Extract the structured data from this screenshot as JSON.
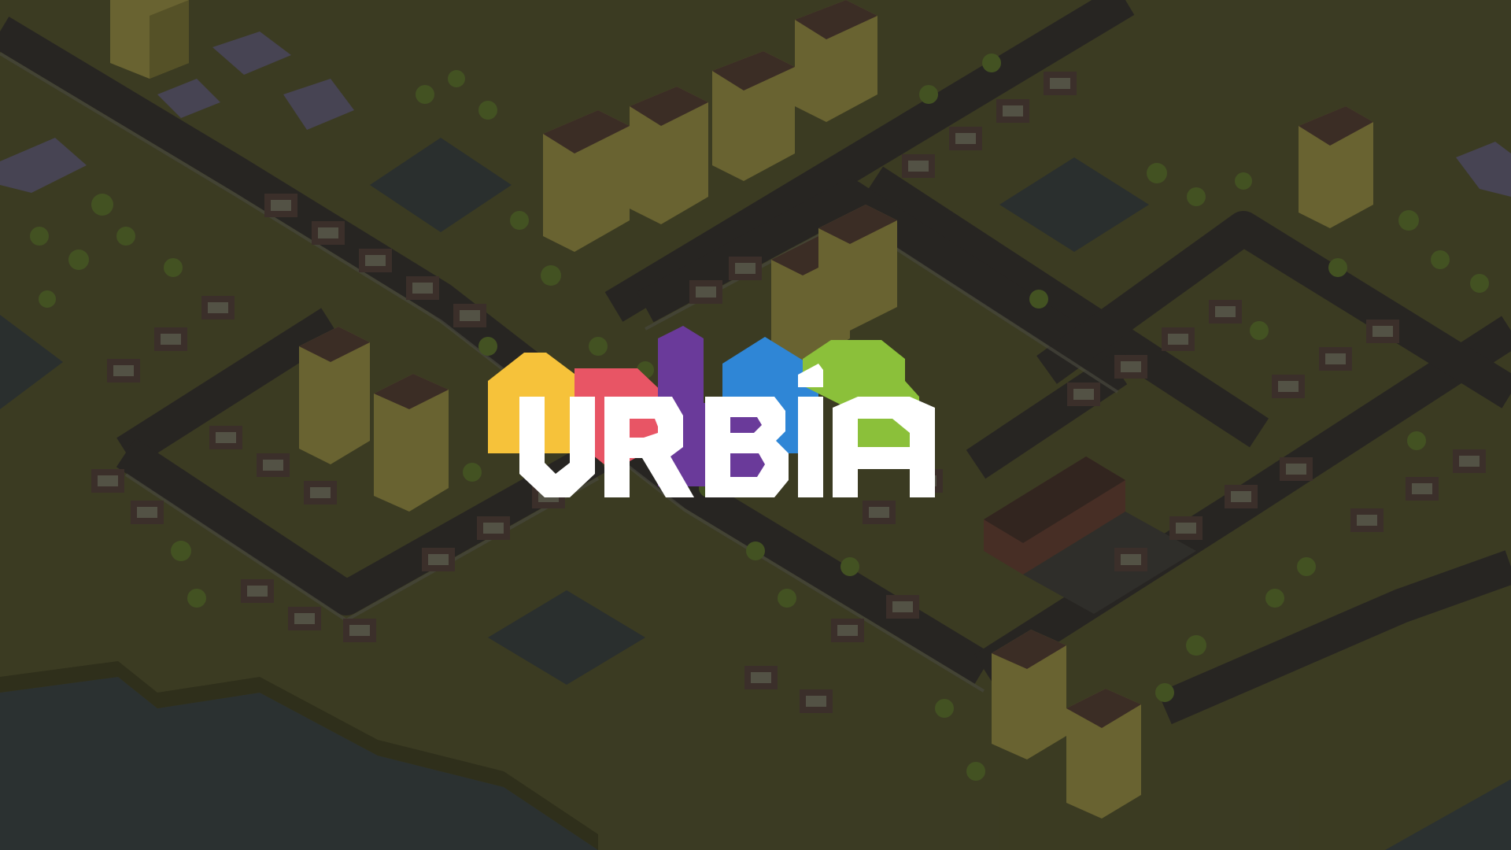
{
  "game": {
    "title": "URBIA",
    "logo_letters": [
      "U",
      "R",
      "B",
      "I",
      "A"
    ]
  },
  "palette": {
    "ground": "#4a4a2c",
    "ground_dark": "#3c3c24",
    "road": "#2f2b2b",
    "sidewalk": "#5a5a50",
    "water": "#343c40",
    "building_wall": "#8a8240",
    "building_side": "#6e6832",
    "roof": "#4a3630",
    "house_wall": "#6b6a5c",
    "house_roof": "#4a3a36",
    "tree": "#556a2c",
    "tree_dark": "#465a24",
    "logo_yellow": "#f6c23a",
    "logo_red": "#e85565",
    "logo_purple": "#6a3a9a",
    "logo_blue": "#2f86d6",
    "logo_green": "#8bc03a",
    "logo_white": "#ffffff"
  }
}
